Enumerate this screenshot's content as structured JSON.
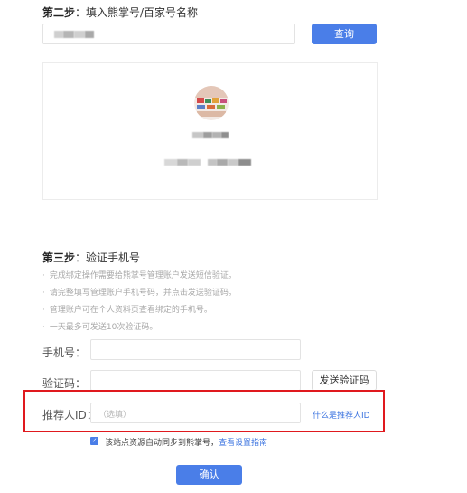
{
  "step2": {
    "title_strong": "第二步",
    "title_rest": "：填入熊掌号/百家号名称",
    "search_button": "查询"
  },
  "step3": {
    "title_strong": "第三步",
    "title_rest": "：验证手机号",
    "hints": [
      "完成绑定操作需要给熊掌号管理账户发送短信验证。",
      "请完整填写管理账户手机号码，并点击发送验证码。",
      "管理账户可在个人资料页查看绑定的手机号。",
      "一天最多可发送10次验证码。"
    ],
    "phone_label": "手机号：",
    "code_label": "验证码：",
    "send_code_button": "发送验证码",
    "referrer_label": "推荐人ID：",
    "referrer_placeholder": "（选填）",
    "referrer_help_link": "什么是推荐人ID",
    "sync_text": "该站点资源自动同步到熊掌号，",
    "sync_link": "查看设置指南",
    "confirm_button": "确认"
  },
  "colors": {
    "primary": "#4a7ee8",
    "highlight": "#e0191e",
    "link": "#3c74e0"
  }
}
